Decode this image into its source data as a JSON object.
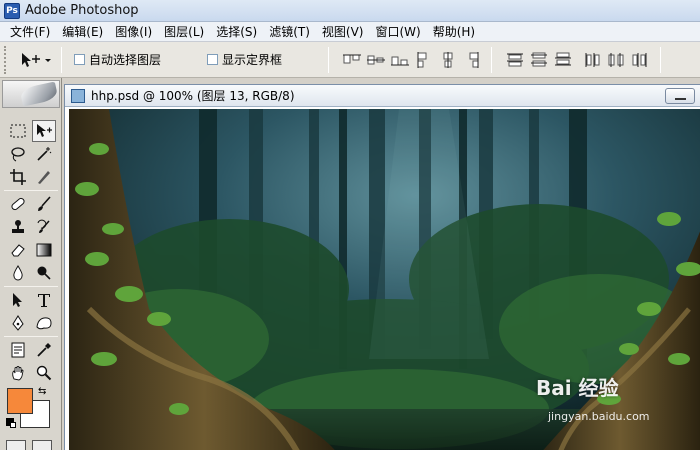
{
  "window": {
    "title": "Adobe Photoshop",
    "logo_text": "Ps"
  },
  "menu": [
    "文件(F)",
    "编辑(E)",
    "图像(I)",
    "图层(L)",
    "选择(S)",
    "滤镜(T)",
    "视图(V)",
    "窗口(W)",
    "帮助(H)"
  ],
  "options": {
    "auto_select_label": "自动选择图层",
    "show_bounds_label": "显示定界框"
  },
  "document": {
    "title": "hhp.psd @ 100% (图层 13, RGB/8)"
  },
  "colors": {
    "foreground": "#f6883a",
    "background": "#ffffff"
  },
  "watermark": {
    "text": "Bai 经验",
    "sub": "jingyan.baidu.com"
  }
}
